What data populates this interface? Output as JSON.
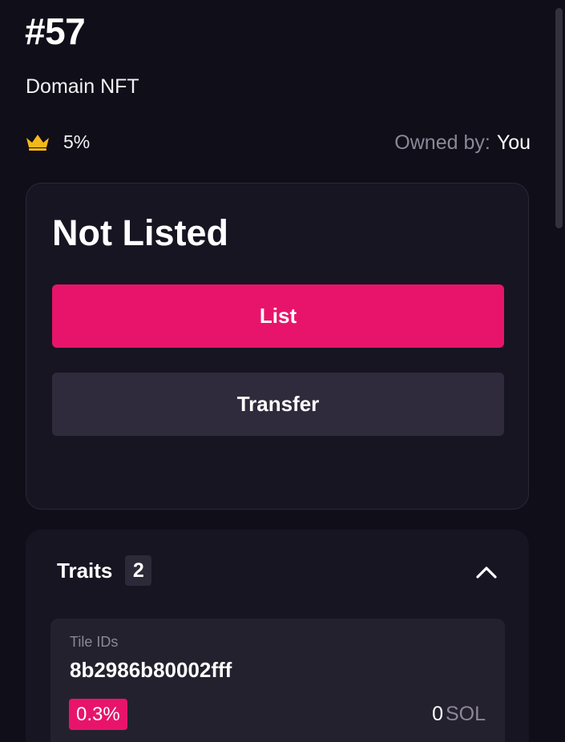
{
  "nft": {
    "title": "#57",
    "collection": "Domain NFT",
    "rarity_rank": "5%",
    "owner_label": "Owned by:",
    "owner_value": "You"
  },
  "status_card": {
    "status": "Not Listed",
    "list_label": "List",
    "transfer_label": "Transfer"
  },
  "traits": {
    "label": "Traits",
    "count": "2",
    "items": [
      {
        "type": "Tile IDs",
        "value": "8b2986b80002fff",
        "rarity": "0.3%",
        "price_amount": "0",
        "price_unit": "SOL"
      }
    ]
  },
  "icons": {
    "rank": "crown-icon",
    "collapse": "chevron-up-icon"
  },
  "colors": {
    "accent": "#e8146b",
    "background": "#100e18",
    "card": "#181522",
    "secondary_button": "#2f2b3c",
    "muted_text": "#8c8798",
    "crown": "#f5b81c"
  }
}
